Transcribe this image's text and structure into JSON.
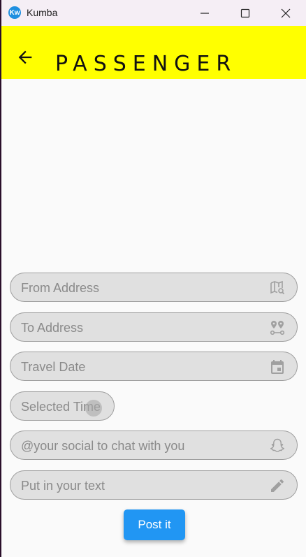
{
  "window": {
    "title": "Kumba",
    "app_icon_text": "Kw",
    "controls": [
      "minimize-icon",
      "maximize-icon",
      "close-icon"
    ]
  },
  "appbar": {
    "title": "PASSENGER",
    "back_icon": "arrow-back-icon",
    "background": "#ffff00"
  },
  "form": {
    "from_address": {
      "placeholder": "From Address",
      "icon": "map-search-icon"
    },
    "to_address": {
      "placeholder": "To Address",
      "icon": "route-pins-icon"
    },
    "travel_date": {
      "placeholder": "Travel Date",
      "icon": "calendar-icon"
    },
    "selected_time": {
      "placeholder": "Selected Time"
    },
    "social": {
      "placeholder": "@your social to chat with you",
      "icon": "snapchat-ghost-icon"
    },
    "text": {
      "placeholder": "Put in your text",
      "icon": "pencil-icon"
    }
  },
  "post_button": {
    "label": "Post it",
    "color": "#2196f3"
  }
}
